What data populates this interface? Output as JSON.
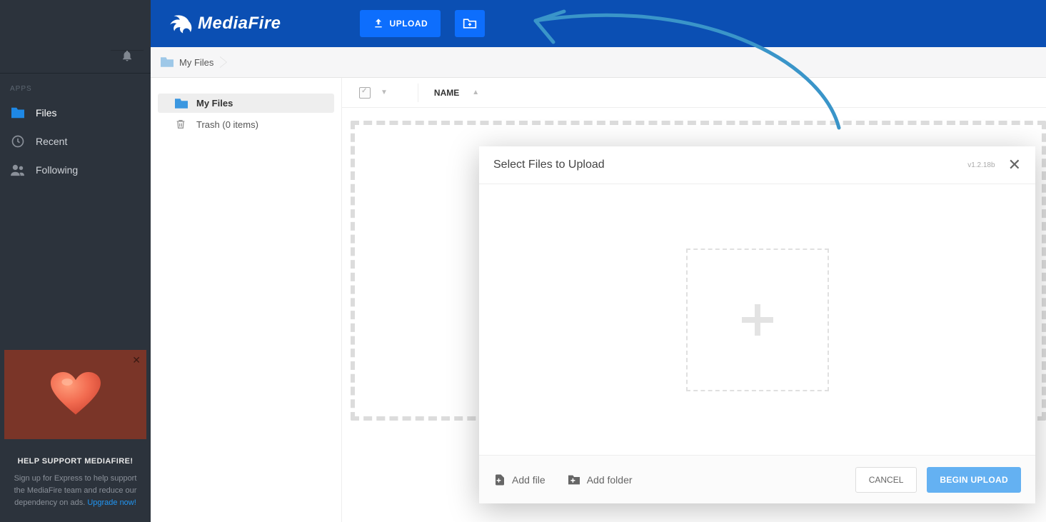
{
  "header": {
    "brand": "MediaFire",
    "upload_label": "UPLOAD"
  },
  "sidebar": {
    "section_label": "APPS",
    "items": [
      {
        "label": "Files"
      },
      {
        "label": "Recent"
      },
      {
        "label": "Following"
      }
    ],
    "support": {
      "title": "HELP SUPPORT MEDIAFIRE!",
      "body": "Sign up for Express to help support the MediaFire team and reduce our dependency on ads. ",
      "link_text": "Upgrade now!"
    }
  },
  "breadcrumb": {
    "root": "My Files"
  },
  "tree": {
    "items": [
      {
        "label": "My Files"
      },
      {
        "label": "Trash (0 items)"
      }
    ]
  },
  "list": {
    "col_name": "NAME"
  },
  "modal": {
    "title": "Select Files to Upload",
    "version": "v1.2.18b",
    "add_file": "Add file",
    "add_folder": "Add folder",
    "cancel": "CANCEL",
    "begin": "BEGIN UPLOAD"
  }
}
